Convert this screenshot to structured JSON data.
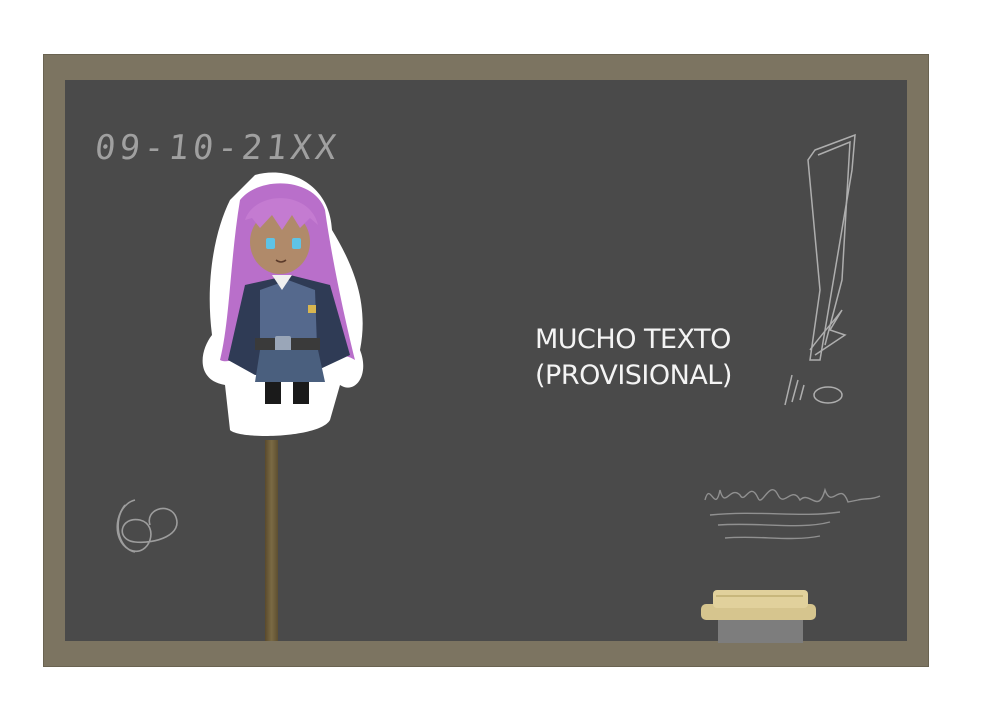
{
  "board": {
    "date": "09-10-21XX",
    "message_line1": "MUCHO TEXTO",
    "message_line2": "(PROVISIONAL)"
  },
  "colors": {
    "frame": "#7c7461",
    "board": "#4a4a4a",
    "chalk": "#d8d8d8",
    "hair": "#c47bd1",
    "uniform": "#4a5f7e"
  }
}
